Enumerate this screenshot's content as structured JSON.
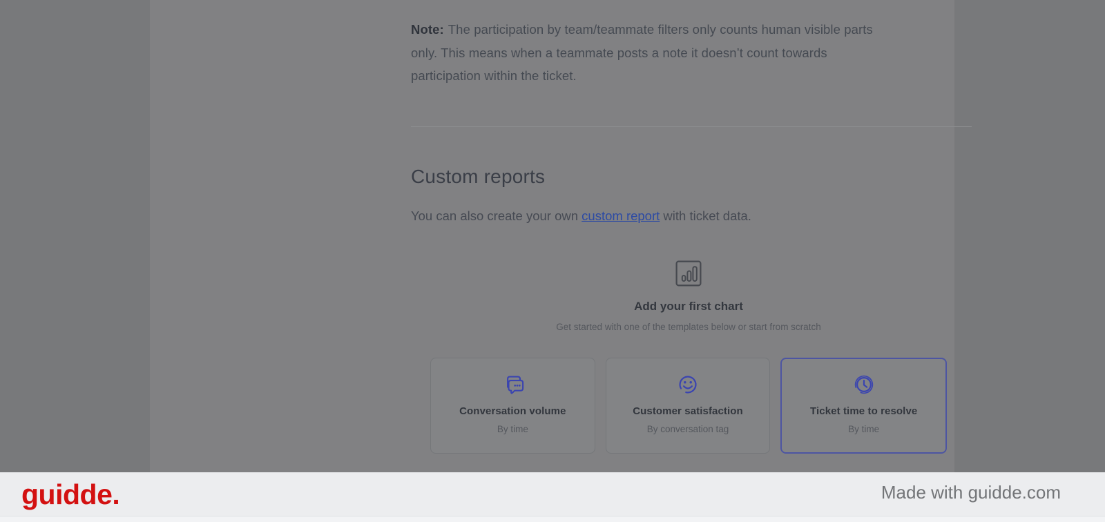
{
  "article": {
    "note": {
      "label": "Note:",
      "lines": [
        "The participation by team/teammate filters only counts human visible parts",
        "only. This means when a teammate posts a note it doesn’t count towards",
        "participation within the ticket."
      ]
    },
    "heading": "Custom reports",
    "intro": {
      "before": "You can also create your own ",
      "link": "custom report",
      "after": " with ticket data."
    }
  },
  "empty_state": {
    "icon": "bar-chart-icon",
    "title": "Add your first chart",
    "subtitle": "Get started with one of the templates below or start from scratch"
  },
  "templates": [
    {
      "icon": "chat-bubbles-icon",
      "title": "Conversation volume",
      "subtitle": "By time",
      "selected": false
    },
    {
      "icon": "smiley-icon",
      "title": "Customer satisfaction",
      "subtitle": "By conversation tag",
      "selected": false
    },
    {
      "icon": "clock-icon",
      "title": "Ticket time to resolve",
      "subtitle": "By time",
      "selected": true
    }
  ],
  "footer": {
    "logo": "guidde.",
    "made_with": "Made with guidde.com"
  },
  "colors": {
    "overlay_background": "#78797b",
    "content_background": "#818183",
    "template_icon_blue": "#3a44b0",
    "selected_card_border": "#4d55a2",
    "link_blue": "#2c4aa4",
    "logo_red": "#d31111",
    "footer_background": "#ecedef"
  }
}
